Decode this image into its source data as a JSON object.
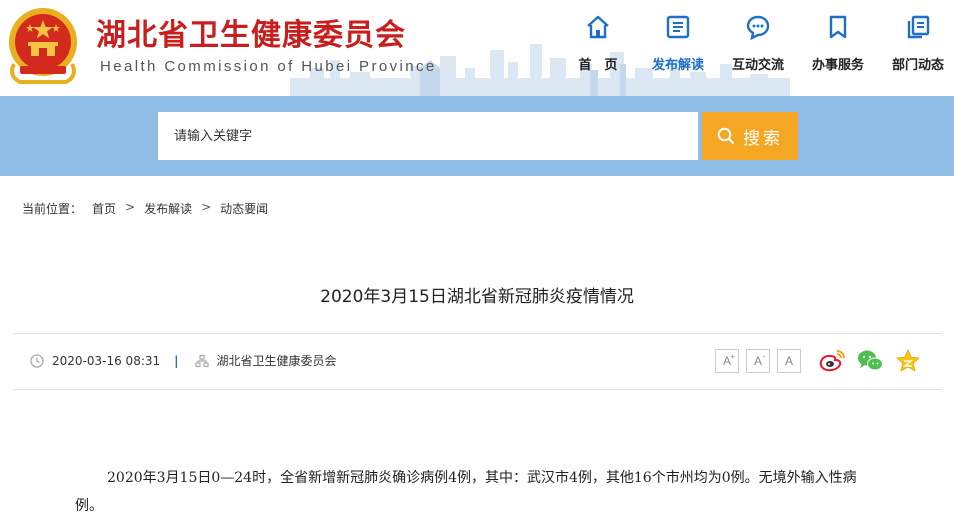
{
  "header": {
    "title": "湖北省卫生健康委员会",
    "subtitle": "Health Commission of Hubei Province",
    "brand_color": "#c81e1e"
  },
  "nav": [
    {
      "label": "首　页",
      "icon": "home-icon"
    },
    {
      "label": "发布解读",
      "icon": "document-icon",
      "active": true
    },
    {
      "label": "互动交流",
      "icon": "chat-icon"
    },
    {
      "label": "办事服务",
      "icon": "bookmark-icon"
    },
    {
      "label": "部门动态",
      "icon": "copy-icon"
    }
  ],
  "search": {
    "placeholder": "请输入关键字",
    "button_label": "搜索",
    "band_color": "#8fbde6",
    "button_color": "#f5a623"
  },
  "breadcrumb": {
    "prefix": "当前位置：",
    "items": [
      "首页",
      "发布解读",
      "动态要闻"
    ],
    "separator": ">"
  },
  "article": {
    "title": "2020年3月15日湖北省新冠肺炎疫情情况",
    "date": "2020-03-16 08:31",
    "divider": "|",
    "source": "湖北省卫生健康委员会",
    "body": "2020年3月15日0—24时，全省新增新冠肺炎确诊病例4例，其中：武汉市4例，其他16个市州均为0例。无境外输入性病例。"
  },
  "toolbar": {
    "font_larger": "A",
    "font_normal": "A",
    "font_smaller": "A",
    "share_icons": [
      "weibo-icon",
      "wechat-icon",
      "favorite-star-icon"
    ]
  }
}
